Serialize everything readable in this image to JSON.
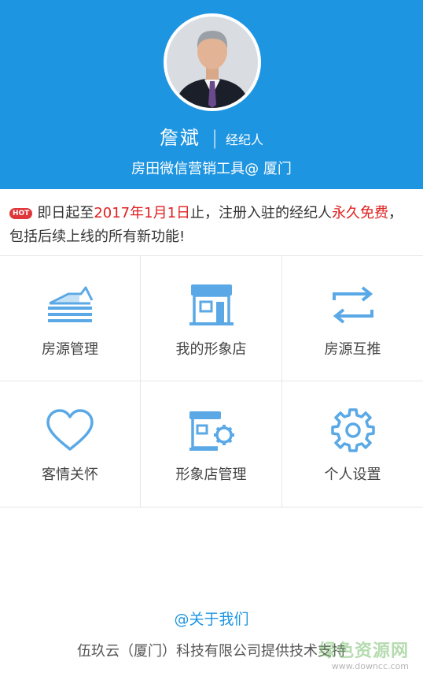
{
  "header": {
    "name": "詹斌",
    "separator": "|",
    "role": "经纪人",
    "subtitle": "房田微信营销工具@ 厦门",
    "bg_color": "#1E95E1"
  },
  "notice": {
    "badge": "HOT",
    "part1": "即日起至",
    "date": "2017年1月1日",
    "part2": "止，注册入驻的经纪人",
    "highlight": "永久免费",
    "part3": "，包括后续上线的所有新功能!"
  },
  "menu": [
    {
      "label": "房源管理",
      "icon": "house-list-icon"
    },
    {
      "label": "我的形象店",
      "icon": "storefront-icon"
    },
    {
      "label": "房源互推",
      "icon": "swap-arrows-icon"
    },
    {
      "label": "客情关怀",
      "icon": "heart-icon"
    },
    {
      "label": "形象店管理",
      "icon": "store-gear-icon"
    },
    {
      "label": "个人设置",
      "icon": "gear-icon"
    }
  ],
  "footer": {
    "about": "@关于我们",
    "support": "伍玖云（厦门）科技有限公司提供技术支持"
  },
  "watermark": {
    "text": "绿色资源网",
    "url": "www.downcc.com"
  },
  "accent_color": "#1E95E1",
  "icon_color": "#5AA9E6",
  "highlight_color": "#E02020"
}
